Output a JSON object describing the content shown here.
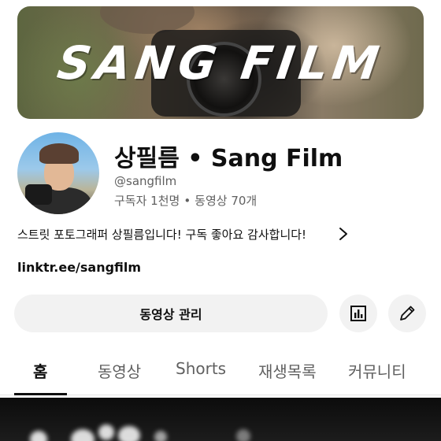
{
  "banner": {
    "title": "SANG FILM"
  },
  "channel": {
    "name": "상필름 • Sang Film",
    "handle": "@sangfilm",
    "subscribers": "구독자 1천명",
    "separator": "•",
    "videos": "동영상 70개",
    "description": "스트릿 포토그래퍼 상필름입니다! 구독 좋아요 감사합니다!",
    "link": "linktr.ee/sangfilm"
  },
  "actions": {
    "manage_videos_label": "동영상 관리",
    "stats_icon": "bar-chart-icon",
    "edit_icon": "pencil-icon"
  },
  "tabs": [
    {
      "label": "홈",
      "active": true
    },
    {
      "label": "동영상",
      "active": false
    },
    {
      "label": "Shorts",
      "active": false
    },
    {
      "label": "재생목록",
      "active": false
    },
    {
      "label": "커뮤니티",
      "active": false
    }
  ],
  "colors": {
    "text_primary": "#0f0f0f",
    "text_secondary": "#606060",
    "button_bg": "#f2f2f2"
  }
}
